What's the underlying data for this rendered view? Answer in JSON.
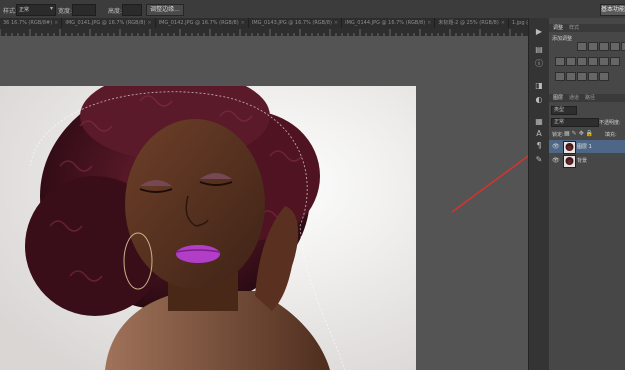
{
  "options_bar": {
    "style_label": "样式:",
    "style_value": "正常",
    "width_label": "宽度:",
    "height_label": "高度:",
    "select_mask_button": "调整边缘...",
    "right_button": "基本功能"
  },
  "doc_tabs": [
    "36 16.7% (RGB/8#)",
    "IMG_0141.JPG @ 16.7% (RGB/8)",
    "IMG_0142.JPG @ 16.7% (RGB/8)",
    "IMG_0143.JPG @ 16.7% (RGB/8)",
    "IMG_0144.JPG @ 16.7% (RGB/8)",
    "未标题-2 @ 25% (RGB/8)",
    "1.jpg @ 25% (RGB/8)"
  ],
  "adjustments_panel": {
    "tabs": [
      "调整",
      "样式"
    ],
    "add_label": "添加调整"
  },
  "layers_panel": {
    "tabs": [
      "图层",
      "通道",
      "路径"
    ],
    "kind_label": "类型",
    "blend_mode": "正常",
    "opacity_label": "不透明度:",
    "lock_label": "锁定:",
    "fill_label": "填充:",
    "layers": [
      {
        "name": "图层 1",
        "selected": true
      },
      {
        "name": "背景",
        "selected": false
      }
    ]
  },
  "tools": [
    "play-icon",
    "histogram-icon",
    "info-icon",
    "layers-icon",
    "adjust-icon",
    "paint-icon",
    "text-icon",
    "paragraph-icon",
    "brush-icon"
  ],
  "colors": {
    "accent_arrow": "#d8322e",
    "selected_layer": "#4e6786",
    "panel_bg": "#474747",
    "canvas_bg": "#545454"
  }
}
